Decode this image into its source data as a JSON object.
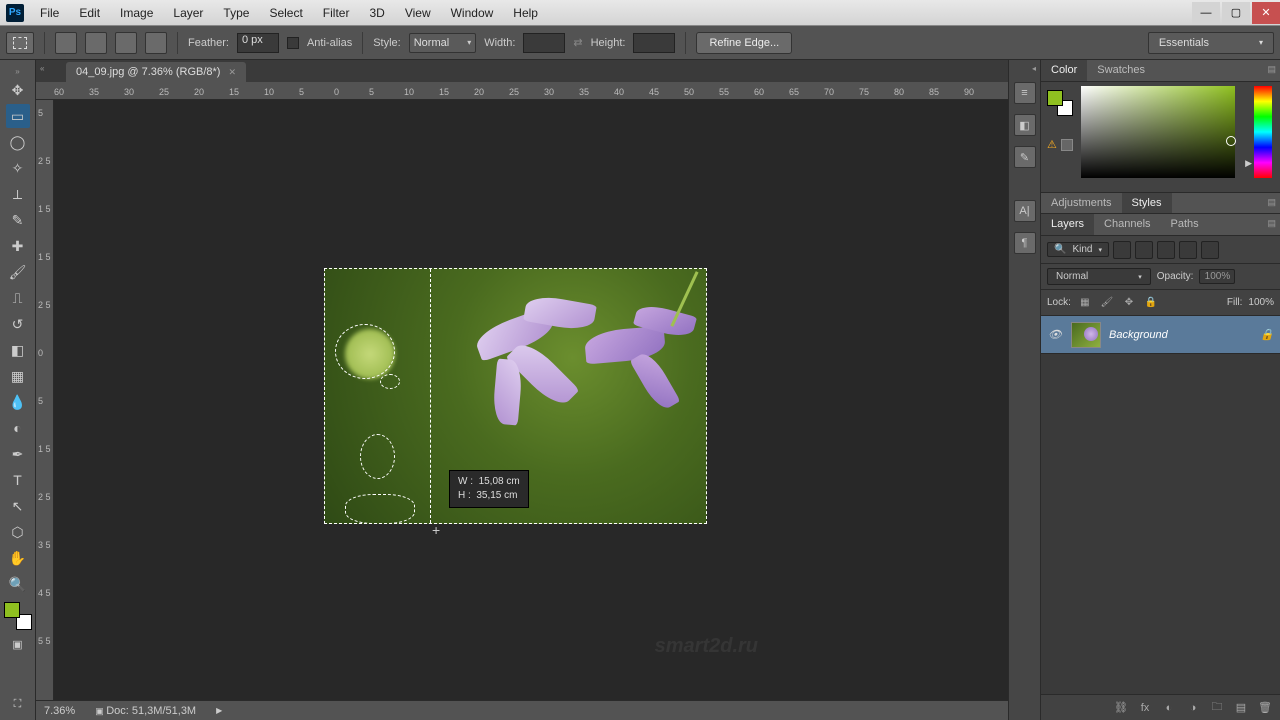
{
  "app": {
    "logo": "Ps"
  },
  "menu": [
    "File",
    "Edit",
    "Image",
    "Layer",
    "Type",
    "Select",
    "Filter",
    "3D",
    "View",
    "Window",
    "Help"
  ],
  "options": {
    "feather_label": "Feather:",
    "feather_value": "0 px",
    "antialias_label": "Anti-alias",
    "style_label": "Style:",
    "style_value": "Normal",
    "width_label": "Width:",
    "width_value": "",
    "height_label": "Height:",
    "height_value": "",
    "refine_btn": "Refine Edge...",
    "workspace": "Essentials"
  },
  "doc": {
    "tab_title": "04_09.jpg @ 7.36% (RGB/8*)",
    "zoom": "7.36%",
    "doc_size_label": "Doc: 51,3M/51,3M",
    "measure_w_label": "W :",
    "measure_w_value": "15,08 cm",
    "measure_h_label": "H :",
    "measure_h_value": "35,15 cm"
  },
  "ruler_h": [
    "60",
    "35",
    "30",
    "25",
    "20",
    "15",
    "10",
    "5",
    "0",
    "5",
    "10",
    "15",
    "20",
    "25",
    "30",
    "35",
    "40",
    "45",
    "50",
    "55",
    "60",
    "65",
    "70",
    "75",
    "80",
    "85",
    "90"
  ],
  "ruler_v": [
    "5",
    "2 5",
    "1 5",
    "1 5",
    "2 5",
    "0",
    "5",
    "1 5",
    "2 5",
    "3 5",
    "4 5",
    "5 5"
  ],
  "panels": {
    "color_tabs": [
      "Color",
      "Swatches"
    ],
    "adj_tabs": [
      "Adjustments",
      "Styles"
    ],
    "layers_tabs": [
      "Layers",
      "Channels",
      "Paths"
    ],
    "filter_label": "Kind",
    "blend_mode": "Normal",
    "opacity_label": "Opacity:",
    "opacity_value": "100%",
    "lock_label": "Lock:",
    "fill_label": "Fill:",
    "fill_value": "100%",
    "layer_name": "Background"
  },
  "watermark": "smart2d.ru"
}
